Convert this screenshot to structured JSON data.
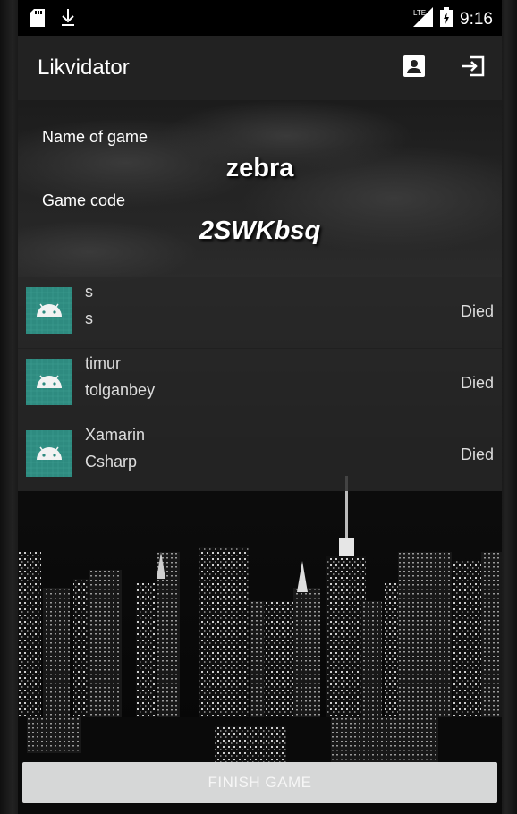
{
  "statusbar": {
    "time": "9:16",
    "network": "LTE",
    "icons": [
      "sd-card-icon",
      "download-icon",
      "lte-signal-icon",
      "battery-charging-icon"
    ]
  },
  "toolbar": {
    "title": "Likvidator",
    "icons": [
      "profile-icon",
      "exit-icon"
    ]
  },
  "game": {
    "name_label": "Name of game",
    "name_value": "zebra",
    "code_label": "Game code",
    "code_value": "2SWKbsq"
  },
  "players": [
    {
      "first": "s",
      "last": "s",
      "status": "Died",
      "icon": "android-icon"
    },
    {
      "first": "timur",
      "last": "tolganbey",
      "status": "Died",
      "icon": "android-icon"
    },
    {
      "first": "Xamarin",
      "last": "Csharp",
      "status": "Died",
      "icon": "android-icon"
    }
  ],
  "actions": {
    "finish_label": "FINISH GAME"
  },
  "colors": {
    "toolbar": "#222222",
    "avatar": "#2e8b80",
    "button": "#d6d7d7"
  }
}
